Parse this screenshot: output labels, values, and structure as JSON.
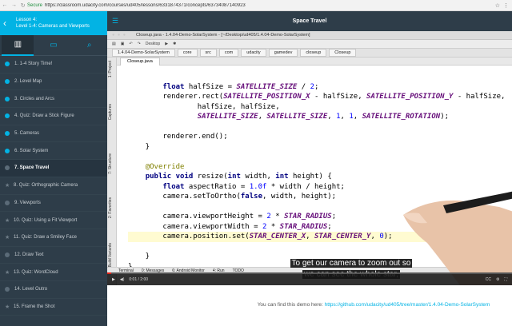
{
  "browser": {
    "secure_label": "Secure",
    "url": "https://classroom.udacity.com/courses/ud405/lessons/6331874371/concepts/63734087140923"
  },
  "sidebar": {
    "lesson_label": "Lesson 4:",
    "lesson_title": "Level 1-4: Cameras and Viewports",
    "concepts": [
      {
        "label": "1. 1-4 Story Time!",
        "status": "done"
      },
      {
        "label": "2. Level Map",
        "status": "done"
      },
      {
        "label": "3. Circles and Arcs",
        "status": "done"
      },
      {
        "label": "4. Quiz: Draw a Stick Figure",
        "status": "done"
      },
      {
        "label": "5. Cameras",
        "status": "done"
      },
      {
        "label": "6. Solar System",
        "status": "done"
      },
      {
        "label": "7. Space Travel",
        "status": "current"
      },
      {
        "label": "8. Quiz: Orthographic Camera",
        "status": "quiz"
      },
      {
        "label": "9. Viewports",
        "status": "todo"
      },
      {
        "label": "10. Quiz: Using a Fit Viewport",
        "status": "quiz"
      },
      {
        "label": "11. Quiz: Draw a Smiley Face",
        "status": "quiz"
      },
      {
        "label": "12. Draw Text",
        "status": "todo"
      },
      {
        "label": "13. Quiz: WordCloud",
        "status": "quiz"
      },
      {
        "label": "14. Level Outro",
        "status": "todo"
      },
      {
        "label": "15. Frame the Shot",
        "status": "quiz"
      }
    ]
  },
  "main": {
    "title": "Space Travel"
  },
  "ide": {
    "window_title": "Closeup.java - 1.4.04-Demo-SolarSystem - [~/Desktop/ud405/1.4.04-Demo-SolarSystem]",
    "run_config": "Desktop",
    "breadcrumbs": [
      "1.4.04-Demo-SolarSystem",
      "core",
      "src",
      "com",
      "udacity",
      "gamedev",
      "closeup",
      "Closeup"
    ],
    "file_tab": "Closeup.java",
    "side_tools": [
      "1: Project",
      "Captures",
      "7: Structure",
      "2: Favorites",
      "Build Variants"
    ],
    "bottom_tools": [
      "Terminal",
      "0: Messages",
      "6: Android Monitor",
      "4: Run",
      "TODO"
    ],
    "status_text": "Gradle build finished with 2 warning(s) in 14s 838ms (9 minutes ago)",
    "code_lines": [
      "",
      "        float halfSize = SATELLITE_SIZE / 2;",
      "        renderer.rect(SATELLITE_POSITION_X - halfSize, SATELLITE_POSITION_Y - halfSize,",
      "                halfSize, halfSize,",
      "                SATELLITE_SIZE, SATELLITE_SIZE, 1, 1, SATELLITE_ROTATION);",
      "",
      "        renderer.end();",
      "    }",
      "",
      "    @Override",
      "    public void resize(int width, int height) {",
      "        float aspectRatio = 1.0f * width / height;",
      "        camera.setToOrtho(false, width, height);",
      "",
      "        camera.viewportHeight = 2 * STAR_RADIUS;",
      "        camera.viewportWidth = 2 * STAR_RADIUS;",
      "        camera.position.set(STAR_CENTER_X, STAR_CENTER_Y, 0);",
      "",
      "    }",
      "}"
    ]
  },
  "video": {
    "subtitle_line1": "To get our camera to zoom out so",
    "subtitle_line2": "we can see the whole star,",
    "time": "0:01 / 2:00",
    "progress": 0.01
  },
  "demo_note": {
    "prefix": "You can find this demo here: ",
    "link": "https://github.com/udacity/ud405/tree/master/1.4.04-Demo-SolarSystem"
  },
  "colors": {
    "accent": "#02b3e4",
    "sidebar_bg": "#2e3d49"
  }
}
